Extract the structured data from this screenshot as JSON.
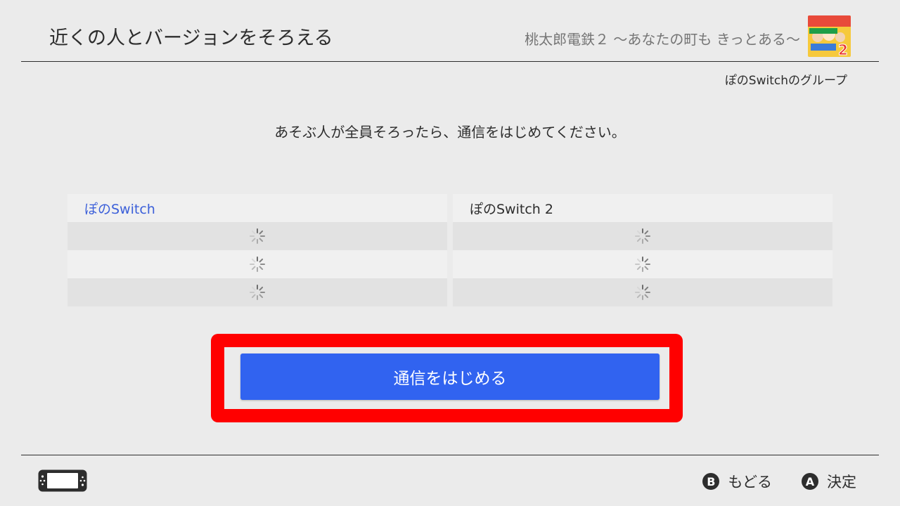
{
  "header": {
    "title": "近くの人とバージョンをそろえる",
    "game_title": "桃太郎電鉄２ 〜あなたの町も きっとある〜",
    "game_thumbnail_icon": "momotetsu-2-game-icon"
  },
  "group_label": "ぽのSwitchのグループ",
  "instruction": "あそぶ人が全員そろったら、通信をはじめてください。",
  "players": [
    {
      "name": "ぽのSwitch",
      "is_self": true,
      "name_color": "#3b5fd9",
      "slots": [
        "loading",
        "loading",
        "loading"
      ]
    },
    {
      "name": "ぽのSwitch 2",
      "is_self": false,
      "name_color": "#2d2d2d",
      "slots": [
        "loading",
        "loading",
        "loading"
      ]
    }
  ],
  "start_button": {
    "label": "通信をはじめる",
    "color": "#3163f0"
  },
  "highlight_color": "#ff0000",
  "footer": {
    "console_icon": "switch-console-icon",
    "back": {
      "glyph": "B",
      "label": "もどる"
    },
    "confirm": {
      "glyph": "A",
      "label": "決定"
    }
  }
}
